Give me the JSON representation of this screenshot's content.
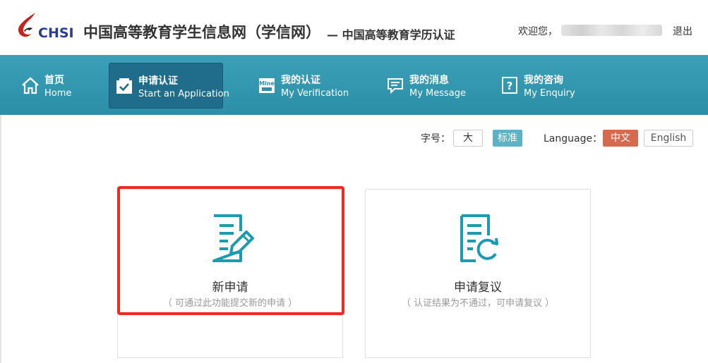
{
  "header": {
    "logo_text": "CHSI",
    "site_title": "中国高等教育学生信息网（学信网）",
    "site_subtitle": "— 中国高等教育学历认证",
    "welcome": "欢迎您，",
    "logout": "退出"
  },
  "nav": {
    "items": [
      {
        "cn": "首页",
        "en": "Home",
        "icon": "home-icon"
      },
      {
        "cn": "申请认证",
        "en": "Start an Application",
        "icon": "check-box-icon"
      },
      {
        "cn": "我的认证",
        "en": "My Verification",
        "icon": "mine-icon"
      },
      {
        "cn": "我的消息",
        "en": "My Message",
        "icon": "message-icon"
      },
      {
        "cn": "我的咨询",
        "en": "My Enquiry",
        "icon": "question-icon"
      }
    ]
  },
  "toolbar": {
    "font_size_label": "字号：",
    "size_large": "大",
    "size_standard": "标准",
    "language_label": "Language：",
    "lang_cn": "中文",
    "lang_en": "English"
  },
  "cards": [
    {
      "title": "新申请",
      "desc": "（ 可通过此功能提交新的申请 ）",
      "icon": "document-edit-icon"
    },
    {
      "title": "申请复议",
      "desc": "（ 认证结果为不通过，可申请复议 ）",
      "icon": "document-refresh-icon"
    }
  ],
  "colors": {
    "nav_bg": "#2c8ea7",
    "nav_active": "#1f6d8a",
    "accent": "#1a9bb0",
    "lang_active": "#d56a4e",
    "size_active": "#5db3c5",
    "highlight": "#ee2a23"
  }
}
